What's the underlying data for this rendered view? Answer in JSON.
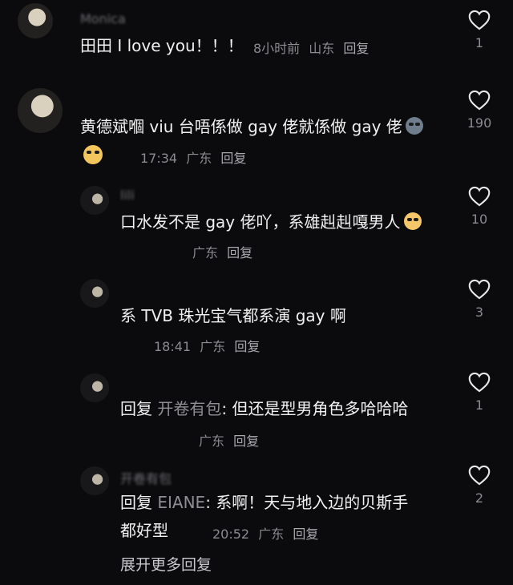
{
  "comments": [
    {
      "username": "Monica",
      "text": "田田 I love you！！！",
      "time": "8小时前",
      "location": "山东",
      "reply_label": "回复",
      "likes": "1"
    },
    {
      "username": "",
      "text": "黄德斌嗰 viu 台唔係做 gay 佬就係做 gay 佬",
      "emoji_1": "sweat-smile-emoji",
      "emoji_2": "sunglasses-emoji",
      "time": "17:34",
      "location": "广东",
      "reply_label": "回复",
      "likes": "190"
    },
    {
      "username": "lili",
      "text": "口水发不是 gay 佬吖，系雄赳赳嘎男人",
      "emoji": "crying-emoji",
      "time": "",
      "location": "广东",
      "reply_label": "回复",
      "likes": "10"
    },
    {
      "username": "",
      "text": "系 TVB 珠光宝气都系演 gay 啊",
      "time": "18:41",
      "location": "广东",
      "reply_label": "回复",
      "likes": "3"
    },
    {
      "username": "",
      "prefix": "回复",
      "target": "开卷有包",
      "text": ": 但还是型男角色多哈哈哈",
      "time": "",
      "location": "广东",
      "reply_label": "回复",
      "likes": "1"
    },
    {
      "username": "开卷有包",
      "prefix": "回复",
      "target": "EIANE",
      "text_line1": ": 系啊！天与地入边的贝斯手",
      "text_line2": "都好型",
      "time": "20:52",
      "location": "广东",
      "reply_label": "回复",
      "likes": "2"
    }
  ],
  "expand_label": "展开更多回复",
  "colors": {
    "background": "#0b0b0d",
    "text": "#f1f1f1",
    "meta": "#8b8b90",
    "heart": "#e8e8ea"
  }
}
